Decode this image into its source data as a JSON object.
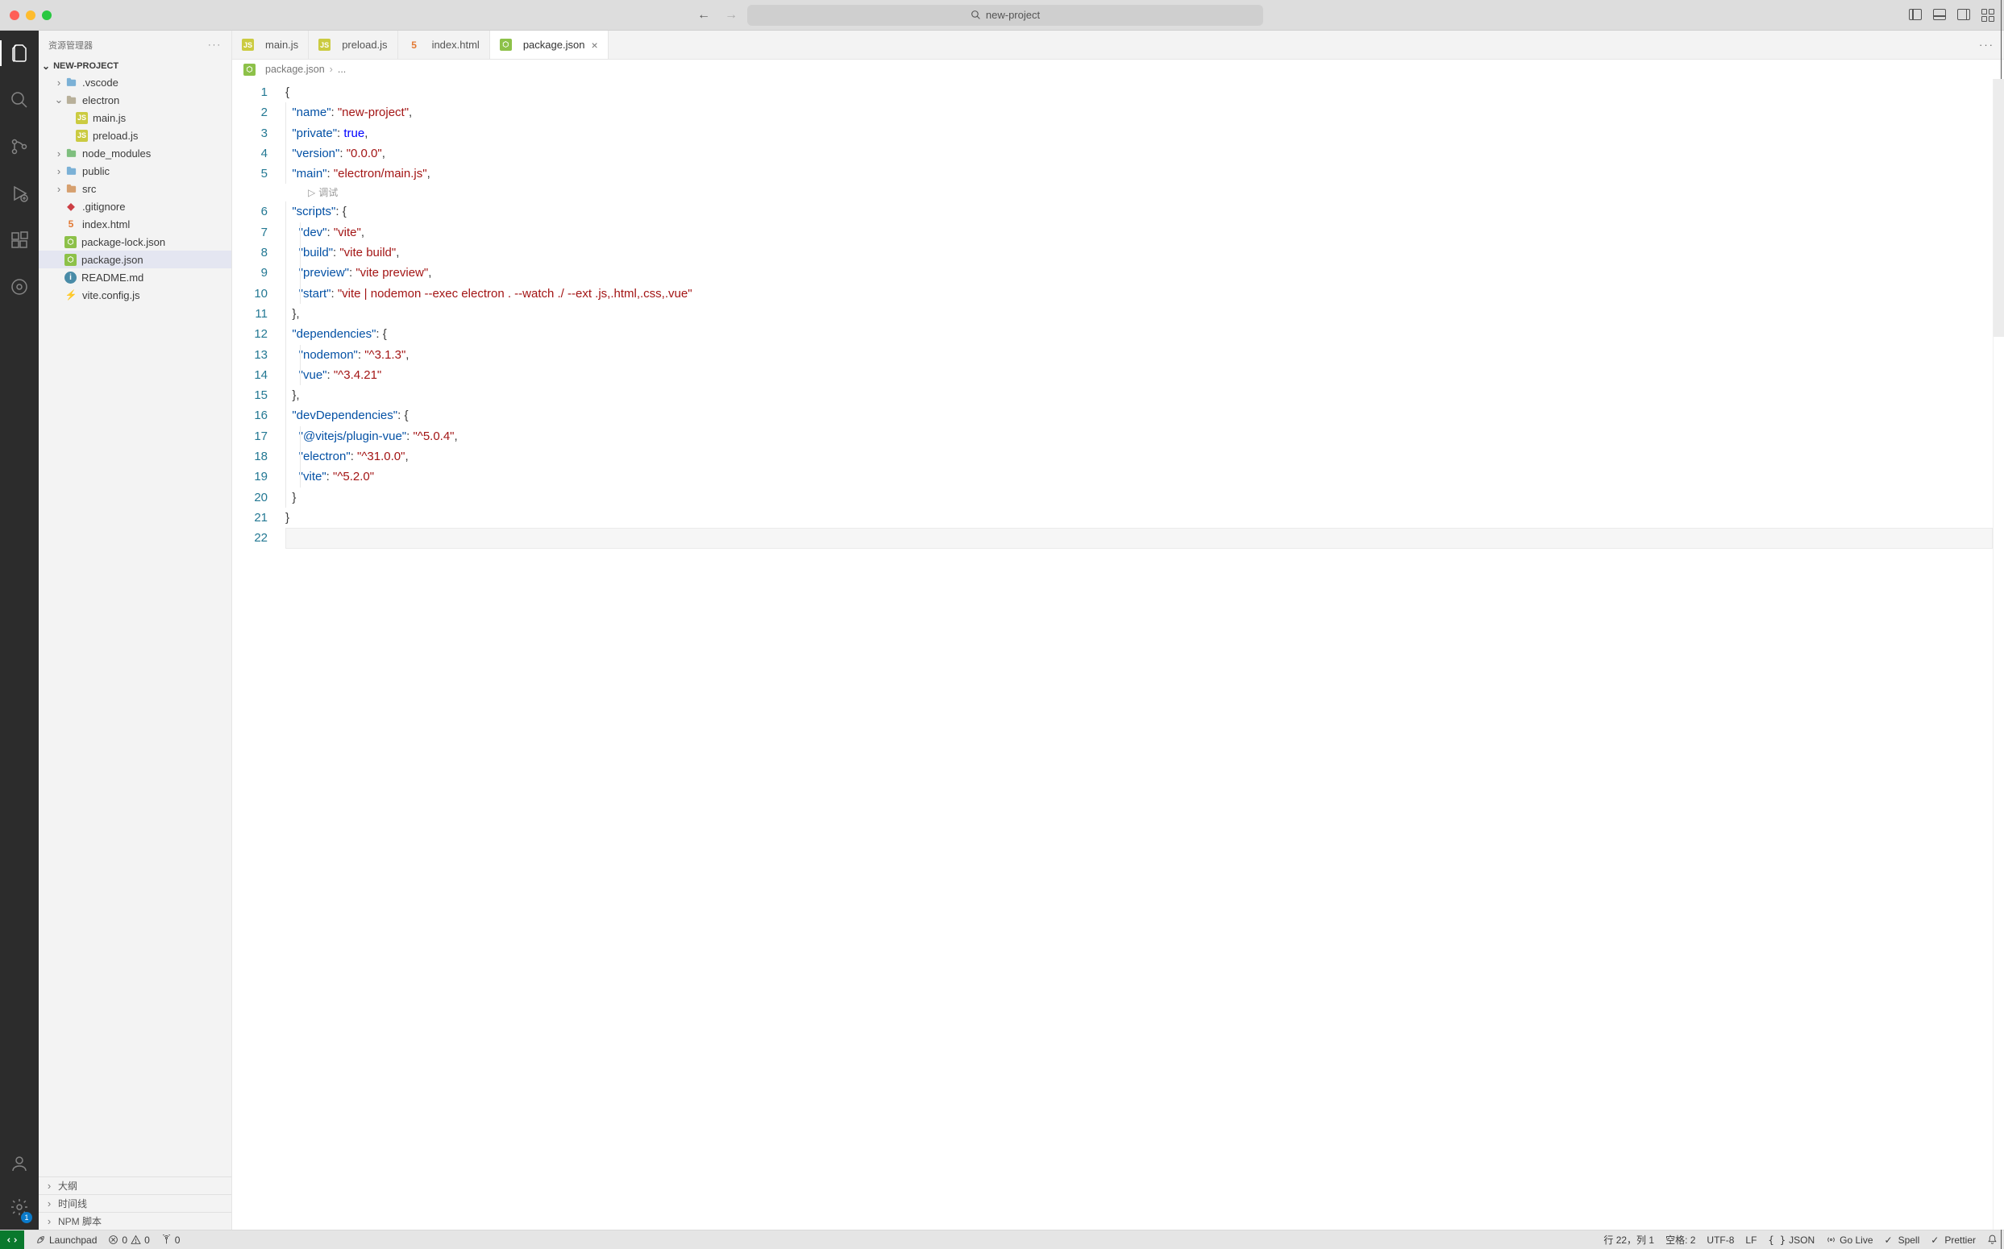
{
  "titlebar": {
    "search_placeholder": "new-project"
  },
  "sidebar": {
    "title": "资源管理器",
    "root": "NEW-PROJECT",
    "tree": [
      {
        "type": "folder",
        "name": ".vscode",
        "expanded": false,
        "iconClass": "fc-folder-blue",
        "indent": 1
      },
      {
        "type": "folder",
        "name": "electron",
        "expanded": true,
        "iconClass": "fc-folder",
        "indent": 1
      },
      {
        "type": "file",
        "name": "main.js",
        "iconClass": "fc-yellow",
        "glyph": "JS",
        "indent": 2
      },
      {
        "type": "file",
        "name": "preload.js",
        "iconClass": "fc-yellow",
        "glyph": "JS",
        "indent": 2
      },
      {
        "type": "folder",
        "name": "node_modules",
        "expanded": false,
        "iconClass": "fc-folder-green",
        "indent": 1
      },
      {
        "type": "folder",
        "name": "public",
        "expanded": false,
        "iconClass": "fc-folder-blue",
        "indent": 1
      },
      {
        "type": "folder",
        "name": "src",
        "expanded": false,
        "iconClass": "fc-folder-orange",
        "indent": 1
      },
      {
        "type": "file",
        "name": ".gitignore",
        "iconClass": "fc-red",
        "glyph": "◆",
        "indent": 1
      },
      {
        "type": "file",
        "name": "index.html",
        "iconClass": "fc-orange",
        "glyph": "5",
        "indent": 1
      },
      {
        "type": "file",
        "name": "package-lock.json",
        "iconClass": "fc-node",
        "glyph": "⬡",
        "indent": 1
      },
      {
        "type": "file",
        "name": "package.json",
        "iconClass": "fc-node",
        "glyph": "⬡",
        "indent": 1,
        "selected": true
      },
      {
        "type": "file",
        "name": "README.md",
        "iconClass": "fc-info",
        "glyph": "i",
        "indent": 1
      },
      {
        "type": "file",
        "name": "vite.config.js",
        "iconClass": "fc-bolt",
        "glyph": "⚡",
        "indent": 1
      }
    ],
    "panels": [
      {
        "label": "大纲"
      },
      {
        "label": "时间线"
      },
      {
        "label": "NPM 脚本"
      }
    ]
  },
  "tabs": [
    {
      "label": "main.js",
      "iconClass": "fc-yellow",
      "glyph": "JS"
    },
    {
      "label": "preload.js",
      "iconClass": "fc-yellow",
      "glyph": "JS"
    },
    {
      "label": "index.html",
      "iconClass": "fc-orange",
      "glyph": "5"
    },
    {
      "label": "package.json",
      "iconClass": "fc-node",
      "glyph": "⬡",
      "active": true,
      "closable": true
    }
  ],
  "breadcrumb": {
    "file": "package.json",
    "tail": "..."
  },
  "codelens": "调试",
  "code_lines": [
    [
      {
        "t": "{",
        "c": "p"
      }
    ],
    [
      {
        "t": "  ",
        "c": "p"
      },
      {
        "t": "\"name\"",
        "c": "k"
      },
      {
        "t": ": ",
        "c": "p"
      },
      {
        "t": "\"new-project\"",
        "c": "s"
      },
      {
        "t": ",",
        "c": "p"
      }
    ],
    [
      {
        "t": "  ",
        "c": "p"
      },
      {
        "t": "\"private\"",
        "c": "k"
      },
      {
        "t": ": ",
        "c": "p"
      },
      {
        "t": "true",
        "c": "c"
      },
      {
        "t": ",",
        "c": "p"
      }
    ],
    [
      {
        "t": "  ",
        "c": "p"
      },
      {
        "t": "\"version\"",
        "c": "k"
      },
      {
        "t": ": ",
        "c": "p"
      },
      {
        "t": "\"0.0.0\"",
        "c": "s"
      },
      {
        "t": ",",
        "c": "p"
      }
    ],
    [
      {
        "t": "  ",
        "c": "p"
      },
      {
        "t": "\"main\"",
        "c": "k"
      },
      {
        "t": ": ",
        "c": "p"
      },
      {
        "t": "\"electron/main.js\"",
        "c": "s"
      },
      {
        "t": ",",
        "c": "p"
      }
    ],
    [
      {
        "t": "  ",
        "c": "p"
      },
      {
        "t": "\"scripts\"",
        "c": "k"
      },
      {
        "t": ": ",
        "c": "p"
      },
      {
        "t": "{",
        "c": "p"
      }
    ],
    [
      {
        "t": "    ",
        "c": "p"
      },
      {
        "t": "\"dev\"",
        "c": "k"
      },
      {
        "t": ": ",
        "c": "p"
      },
      {
        "t": "\"vite\"",
        "c": "s"
      },
      {
        "t": ",",
        "c": "p"
      }
    ],
    [
      {
        "t": "    ",
        "c": "p"
      },
      {
        "t": "\"build\"",
        "c": "k"
      },
      {
        "t": ": ",
        "c": "p"
      },
      {
        "t": "\"vite build\"",
        "c": "s"
      },
      {
        "t": ",",
        "c": "p"
      }
    ],
    [
      {
        "t": "    ",
        "c": "p"
      },
      {
        "t": "\"preview\"",
        "c": "k"
      },
      {
        "t": ": ",
        "c": "p"
      },
      {
        "t": "\"vite preview\"",
        "c": "s"
      },
      {
        "t": ",",
        "c": "p"
      }
    ],
    [
      {
        "t": "    ",
        "c": "p"
      },
      {
        "t": "\"start\"",
        "c": "k"
      },
      {
        "t": ": ",
        "c": "p"
      },
      {
        "t": "\"vite | nodemon --exec electron . --watch ./ --ext .js,.html,.css,.vue\"",
        "c": "s"
      }
    ],
    [
      {
        "t": "  ",
        "c": "p"
      },
      {
        "t": "}",
        "c": "p"
      },
      {
        "t": ",",
        "c": "p"
      }
    ],
    [
      {
        "t": "  ",
        "c": "p"
      },
      {
        "t": "\"dependencies\"",
        "c": "k"
      },
      {
        "t": ": ",
        "c": "p"
      },
      {
        "t": "{",
        "c": "p"
      }
    ],
    [
      {
        "t": "    ",
        "c": "p"
      },
      {
        "t": "\"nodemon\"",
        "c": "k"
      },
      {
        "t": ": ",
        "c": "p"
      },
      {
        "t": "\"^3.1.3\"",
        "c": "s"
      },
      {
        "t": ",",
        "c": "p"
      }
    ],
    [
      {
        "t": "    ",
        "c": "p"
      },
      {
        "t": "\"vue\"",
        "c": "k"
      },
      {
        "t": ": ",
        "c": "p"
      },
      {
        "t": "\"^3.4.21\"",
        "c": "s"
      }
    ],
    [
      {
        "t": "  ",
        "c": "p"
      },
      {
        "t": "}",
        "c": "p"
      },
      {
        "t": ",",
        "c": "p"
      }
    ],
    [
      {
        "t": "  ",
        "c": "p"
      },
      {
        "t": "\"devDependencies\"",
        "c": "k"
      },
      {
        "t": ": ",
        "c": "p"
      },
      {
        "t": "{",
        "c": "p"
      }
    ],
    [
      {
        "t": "    ",
        "c": "p"
      },
      {
        "t": "\"@vitejs/plugin-vue\"",
        "c": "k"
      },
      {
        "t": ": ",
        "c": "p"
      },
      {
        "t": "\"^5.0.4\"",
        "c": "s"
      },
      {
        "t": ",",
        "c": "p"
      }
    ],
    [
      {
        "t": "    ",
        "c": "p"
      },
      {
        "t": "\"electron\"",
        "c": "k"
      },
      {
        "t": ": ",
        "c": "p"
      },
      {
        "t": "\"^31.0.0\"",
        "c": "s"
      },
      {
        "t": ",",
        "c": "p"
      }
    ],
    [
      {
        "t": "    ",
        "c": "p"
      },
      {
        "t": "\"vite\"",
        "c": "k"
      },
      {
        "t": ": ",
        "c": "p"
      },
      {
        "t": "\"^5.2.0\"",
        "c": "s"
      }
    ],
    [
      {
        "t": "  ",
        "c": "p"
      },
      {
        "t": "}",
        "c": "p"
      }
    ],
    [
      {
        "t": "}",
        "c": "p"
      }
    ],
    []
  ],
  "status": {
    "launchpad": "Launchpad",
    "errors": "0",
    "warnings": "0",
    "ports": "0",
    "cursor": "行 22，列 1",
    "spaces": "空格: 2",
    "encoding": "UTF-8",
    "eol": "LF",
    "lang": "JSON",
    "golive": "Go Live",
    "spell": "Spell",
    "prettier": "Prettier"
  },
  "settings_badge": "1"
}
